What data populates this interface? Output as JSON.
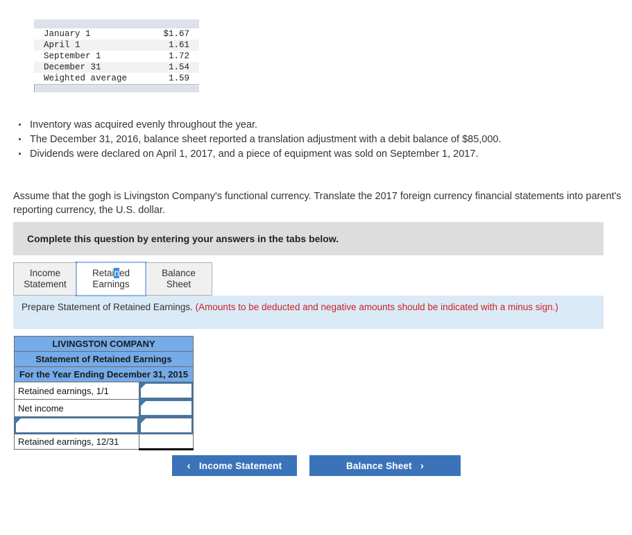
{
  "rate_table": {
    "rows": [
      {
        "label": "January 1",
        "value": "$1.67"
      },
      {
        "label": "April 1",
        "value": "1.61"
      },
      {
        "label": "September 1",
        "value": "1.72"
      },
      {
        "label": "December 31",
        "value": "1.54"
      },
      {
        "label": "Weighted average",
        "value": "1.59"
      }
    ]
  },
  "bullets": [
    "Inventory was acquired evenly throughout the year.",
    "The December 31, 2016, balance sheet reported a translation adjustment with a debit balance of $85,000.",
    "Dividends were declared on April 1, 2017, and a piece of equipment was sold on September 1, 2017."
  ],
  "assume_paragraph": "Assume that the gogh is Livingston Company's functional currency. Translate the 2017 foreign currency financial statements into parent's reporting currency, the U.S. dollar.",
  "banner": {
    "text": "Complete this question by entering your answers in the tabs below."
  },
  "tabs": [
    {
      "label_line1": "Income",
      "label_line2": "Statement",
      "active": false
    },
    {
      "label_line1": "Retained",
      "label_line2": "Earnings",
      "active": true
    },
    {
      "label_line1": "Balance Sheet",
      "label_line2": "",
      "active": false
    }
  ],
  "tab_selection": {
    "prefix": "Retai",
    "selected_char": "n",
    "suffix": "ed",
    "second_line": "Earnings"
  },
  "instruction": {
    "black_text": "Prepare Statement of Retained Earnings.",
    "red_text": "(Amounts to be deducted and negative amounts should be indicated with a minus sign.)"
  },
  "statement": {
    "title_lines": [
      "LIVINGSTON COMPANY",
      "Statement of Retained Earnings",
      "For the Year Ending December 31, 2015"
    ],
    "rows": [
      {
        "label": "Retained earnings, 1/1",
        "label_input": false,
        "value": "",
        "value_input": true,
        "total": false
      },
      {
        "label": "Net income",
        "label_input": false,
        "value": "",
        "value_input": true,
        "total": false
      },
      {
        "label": "",
        "label_input": true,
        "value": "",
        "value_input": true,
        "total": false
      },
      {
        "label": "Retained earnings, 12/31",
        "label_input": false,
        "value": "",
        "value_input": false,
        "total": true
      }
    ]
  },
  "nav": {
    "prev_label": "Income Statement",
    "prev_chevron": "‹",
    "next_label": "Balance Sheet",
    "next_chevron": "›"
  },
  "colors": {
    "header_blue": "#74abe8",
    "button_blue": "#3b73b9",
    "instruction_bg": "#daeaf7",
    "banner_gray": "#dddddd",
    "red_text": "#cc2222",
    "input_border": "#3e77ac"
  }
}
